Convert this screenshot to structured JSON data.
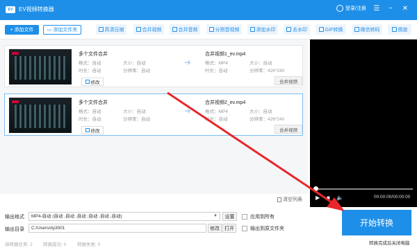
{
  "app": {
    "title": "EV视频转换器",
    "logo": "EV"
  },
  "titlebar": {
    "login": "登录/注册",
    "menu_icon": "menu-icon",
    "minimize_icon": "minimize-icon",
    "close_icon": "close-icon"
  },
  "toolbar": {
    "add_file": "添加文件",
    "add_folder": "添加文件夹",
    "tools": [
      "高清压缩",
      "合并视频",
      "合并音频",
      "分割音视频",
      "添加水印",
      "去水印",
      "GIF转换",
      "微信转码",
      "倒放"
    ]
  },
  "files": [
    {
      "name": "多个文件合并",
      "format": "格式：自动",
      "size": "大小：自动",
      "duration": "时长：自动",
      "resolution": "分辨率：自动",
      "edit": "修改",
      "output_name": "合并视频1_ev.mp4",
      "out_format": "格式：MP4",
      "out_size": "大小：自动",
      "out_duration": "时长：自动",
      "out_resolution": "分辨率：426*240",
      "merge": "合并视频"
    },
    {
      "name": "多个文件合并",
      "format": "格式：自动",
      "size": "大小：自动",
      "duration": "时长：自动",
      "resolution": "分辨率：自动",
      "edit": "修改",
      "output_name": "合并视频2_ev.mp4",
      "out_format": "格式：MP4",
      "out_size": "大小：自动",
      "out_duration": "时长：自动",
      "out_resolution": "分辨率：426*240",
      "merge": "合并视频"
    }
  ],
  "list": {
    "clear": "清空列表"
  },
  "player": {
    "time": "00:00:00/00:00:00"
  },
  "output": {
    "format_label": "输出格式",
    "format_value": "MP4-自动 (自动 ,自动 ,自动 ;自动 ,自动 ,自动)",
    "settings": "设置",
    "apply_all": "应用到所有",
    "dir_label": "输出目录",
    "dir_value": "C:/Users/dy3001",
    "modify": "修改",
    "open": "打开",
    "to_source": "输出到原文件夹",
    "start": "开始转换",
    "shutdown": "转换完成后关闭电脑"
  },
  "status": {
    "pending": "待转换任务: 2",
    "success": "转换成功: 0",
    "failed": "转换失败: 0"
  },
  "colors": {
    "accent": "#1e8fe8",
    "annotation": "#e8262b"
  }
}
